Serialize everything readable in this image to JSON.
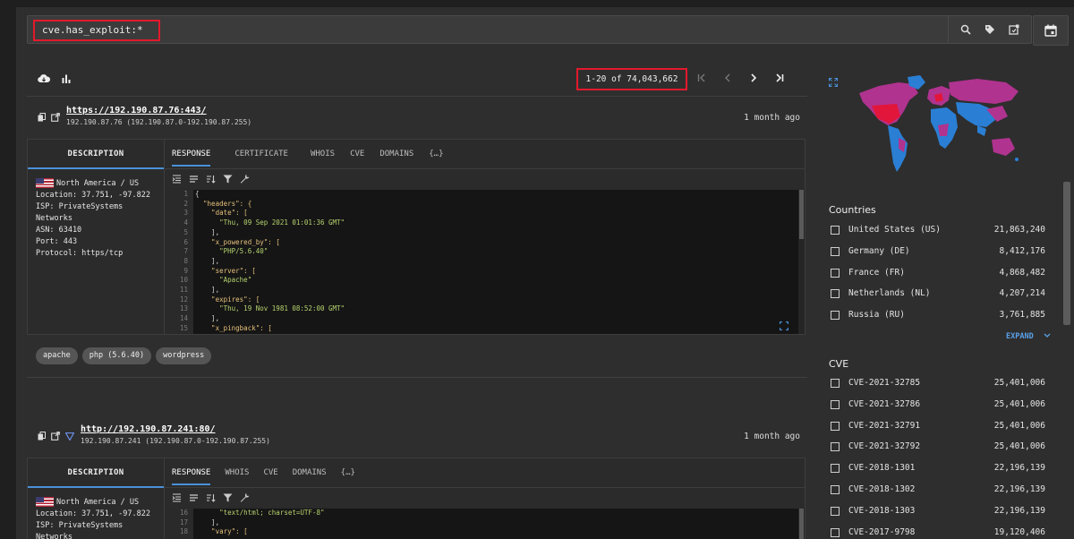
{
  "search": {
    "query": "cve.has_exploit:*"
  },
  "toolbar": {
    "paging_text": "1-20 of 74,043,662"
  },
  "results": [
    {
      "url_scheme": "https://",
      "url_host": "192.190.87.76:443/",
      "ip_line": "192.190.87.76 (192.190.87.0-192.190.87.255)",
      "time": "1 month ago",
      "desc_tab": "DESCRIPTION",
      "tabs": [
        "RESPONSE",
        "CERTIFICATE",
        "WHOIS",
        "CVE",
        "DOMAINS",
        "{…}"
      ],
      "desc": {
        "region": "North America / US",
        "location": "Location: 37.751, -97.822",
        "isp": "ISP: PrivateSystems Networks",
        "asn": "ASN: 63410",
        "port": "Port: 443",
        "protocol": "Protocol: https/tcp"
      },
      "tags": [
        "apache",
        "php (5.6.40)",
        "wordpress"
      ]
    },
    {
      "url_scheme": "http://",
      "url_host": "192.190.87.241:80/",
      "ip_line": "192.190.87.241 (192.190.87.0-192.190.87.255)",
      "time": "1 month ago",
      "desc_tab": "DESCRIPTION",
      "tabs": [
        "RESPONSE",
        "WHOIS",
        "CVE",
        "DOMAINS",
        "{…}"
      ],
      "desc": {
        "region": "North America / US",
        "location": "Location: 37.751, -97.822",
        "isp": "ISP: PrivateSystems Networks"
      }
    }
  ],
  "code1": {
    "line_numbers": [
      "1",
      "2",
      "3",
      "4",
      "5",
      "6",
      "7",
      "8",
      "9",
      "10",
      "11",
      "12",
      "13",
      "14",
      "15"
    ],
    "lines": [
      "{",
      "  \"headers\": {",
      "    \"date\": [",
      "      \"Thu, 09 Sep 2021 01:01:36 GMT\"",
      "    ],",
      "    \"x_powered_by\": [",
      "      \"PHP/5.6.40\"",
      "    ],",
      "    \"server\": [",
      "      \"Apache\"",
      "    ],",
      "    \"expires\": [",
      "      \"Thu, 19 Nov 1981 08:52:00 GMT\"",
      "    ],",
      "    \"x_pingback\": ["
    ]
  },
  "code2": {
    "line_numbers": [
      "16",
      "17",
      "18"
    ],
    "lines": [
      "      \"text/html; charset=UTF-8\"",
      "    ],",
      "    \"vary\": ["
    ]
  },
  "countries": {
    "title": "Countries",
    "items": [
      {
        "label": "United States (US)",
        "count": "21,863,240"
      },
      {
        "label": "Germany (DE)",
        "count": "8,412,176"
      },
      {
        "label": "France (FR)",
        "count": "4,868,482"
      },
      {
        "label": "Netherlands (NL)",
        "count": "4,207,214"
      },
      {
        "label": "Russia (RU)",
        "count": "3,761,885"
      }
    ],
    "expand_label": "EXPAND"
  },
  "cve": {
    "title": "CVE",
    "items": [
      {
        "label": "CVE-2021-32785",
        "count": "25,401,006"
      },
      {
        "label": "CVE-2021-32786",
        "count": "25,401,006"
      },
      {
        "label": "CVE-2021-32791",
        "count": "25,401,006"
      },
      {
        "label": "CVE-2021-32792",
        "count": "25,401,006"
      },
      {
        "label": "CVE-2018-1301",
        "count": "22,196,139"
      },
      {
        "label": "CVE-2018-1302",
        "count": "22,196,139"
      },
      {
        "label": "CVE-2018-1303",
        "count": "22,196,139"
      },
      {
        "label": "CVE-2017-9798",
        "count": "19,120,406"
      }
    ]
  },
  "colors": {
    "accent": "#4a90d9",
    "highlight_border": "#e2192c",
    "map_magenta": "#b0338f",
    "map_blue": "#2a7fd4"
  }
}
